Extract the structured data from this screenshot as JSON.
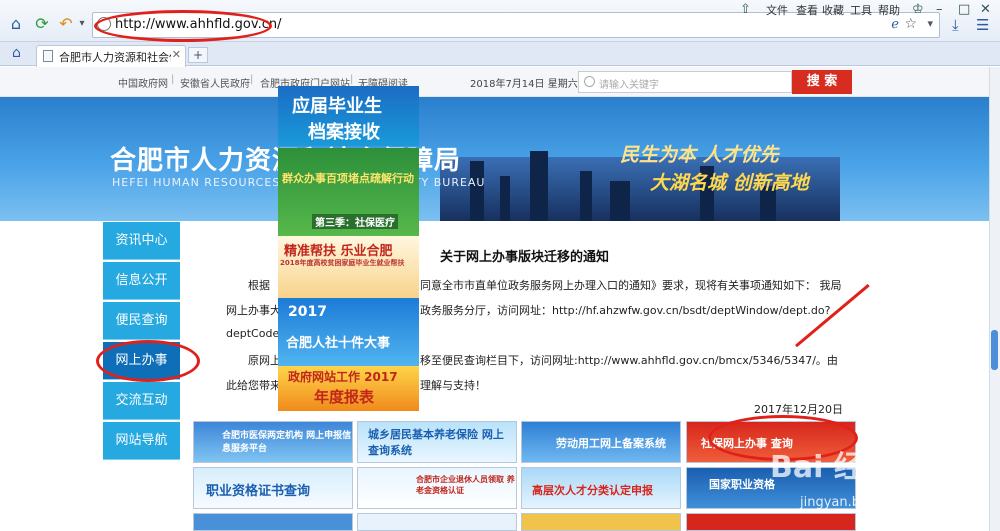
{
  "browser": {
    "url": "http://www.ahhfld.gov.cn/",
    "tab_title": "合肥市人力资源和社会保",
    "menu": [
      "文件",
      "查看",
      "收藏",
      "工具",
      "帮助"
    ],
    "new_tab": "+"
  },
  "site": {
    "top_links": [
      "中国政府网",
      "安徽省人民政府",
      "合肥市政府门户网站",
      "无障碍阅读"
    ],
    "date": "2018年7月14日  星期六",
    "search_placeholder": "请输入关键字",
    "search_button": "搜 索",
    "title": "合肥市人力资源和社会保障局",
    "subtitle": "HEFEI HUMAN RESOURCES AND SOCIAL SECURITY BUREAU",
    "slogan1": "民生为本  人才优先",
    "slogan2": "大湖名城  创新高地"
  },
  "nav": [
    {
      "label": "资讯中心"
    },
    {
      "label": "信息公开"
    },
    {
      "label": "便民查询"
    },
    {
      "label": "网上办事"
    },
    {
      "label": "交流互动"
    },
    {
      "label": "网站导航"
    }
  ],
  "notice": {
    "title": "关于网上办事版块迁移的通知",
    "lines": [
      "根据",
      "同意全市市直单位政务服务网上办理入口的通知》要求，现将有关事项通知如下：  我局",
      "网上办事大",
      "政务服务分厅，访问网址：http://hf.ahzwfw.gov.cn/bsdt/deptWindow/dept.do?",
      "deptCode",
      "原网上",
      "移至便民查询栏目下，访问网址:http://www.ahhfld.gov.cn/bmcx/5346/5347/。由",
      "此给您带来",
      "理解与支持！"
    ],
    "date": "2017年12月20日"
  },
  "ads": [
    {
      "text": "应届毕业生",
      "text2": "档案接收"
    },
    {
      "text": "群众办事百项堵点疏解行动",
      "text2": "第三季：社保医疗"
    },
    {
      "text": "精准帮扶 乐业合肥",
      "text2": "2018年度高校贫困家庭毕业生就业帮扶"
    },
    {
      "text": "2017",
      "text2": "合肥人社十件大事"
    },
    {
      "text": "政府网站工作 2017",
      "text2": "年度报表"
    }
  ],
  "tiles": [
    {
      "label": "合肥市医保两定机构 网上申报信息服务平台"
    },
    {
      "label": "城乡居民基本养老保险 网上查询系统"
    },
    {
      "label": "劳动用工网上备案系统"
    },
    {
      "label": "社保网上办事 查询"
    },
    {
      "label": "职业资格证书查询"
    },
    {
      "label": "合肥市企业退休人员领取 养老金资格认证"
    },
    {
      "label": "高层次人才分类认定申报"
    },
    {
      "label": "国家职业资格"
    }
  ],
  "watermark": "Bai 经验",
  "watermark_sub": "jingyan.baidu.com",
  "colors": {
    "accent_red": "#d72d21",
    "nav_blue": "#26a9e0",
    "nav_active": "#0e6fb8",
    "annotation": "#e0211b"
  }
}
